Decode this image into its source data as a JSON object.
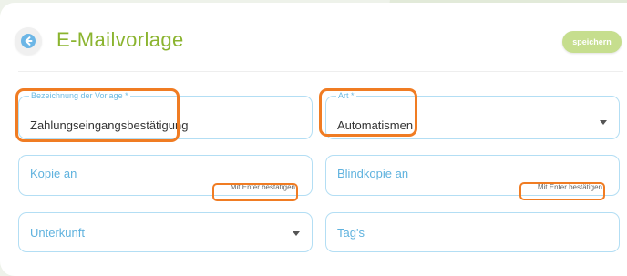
{
  "page": {
    "title": "E-Mailvorlage",
    "back_icon": "arrow-left-icon",
    "save_label": "speichern"
  },
  "form": {
    "bezeichnung": {
      "label": "Bezeichnung der Vorlage *",
      "value": "Zahlungseingangsbestätigung"
    },
    "art": {
      "label": "Art *",
      "value": "Automatismen"
    },
    "kopie_an": {
      "placeholder": "Kopie an",
      "hint": "Mit Enter bestätigen"
    },
    "blindkopie_an": {
      "placeholder": "Blindkopie an",
      "hint": "Mit Enter bestätigen"
    },
    "unterkunft": {
      "placeholder": "Unterkunft"
    },
    "tags": {
      "placeholder": "Tag's"
    }
  },
  "colors": {
    "accent": "#8bb42f",
    "save_button": "#c6de8e",
    "field_border": "#b3def4",
    "label": "#5fb2de",
    "annotation": "#f07c23"
  }
}
